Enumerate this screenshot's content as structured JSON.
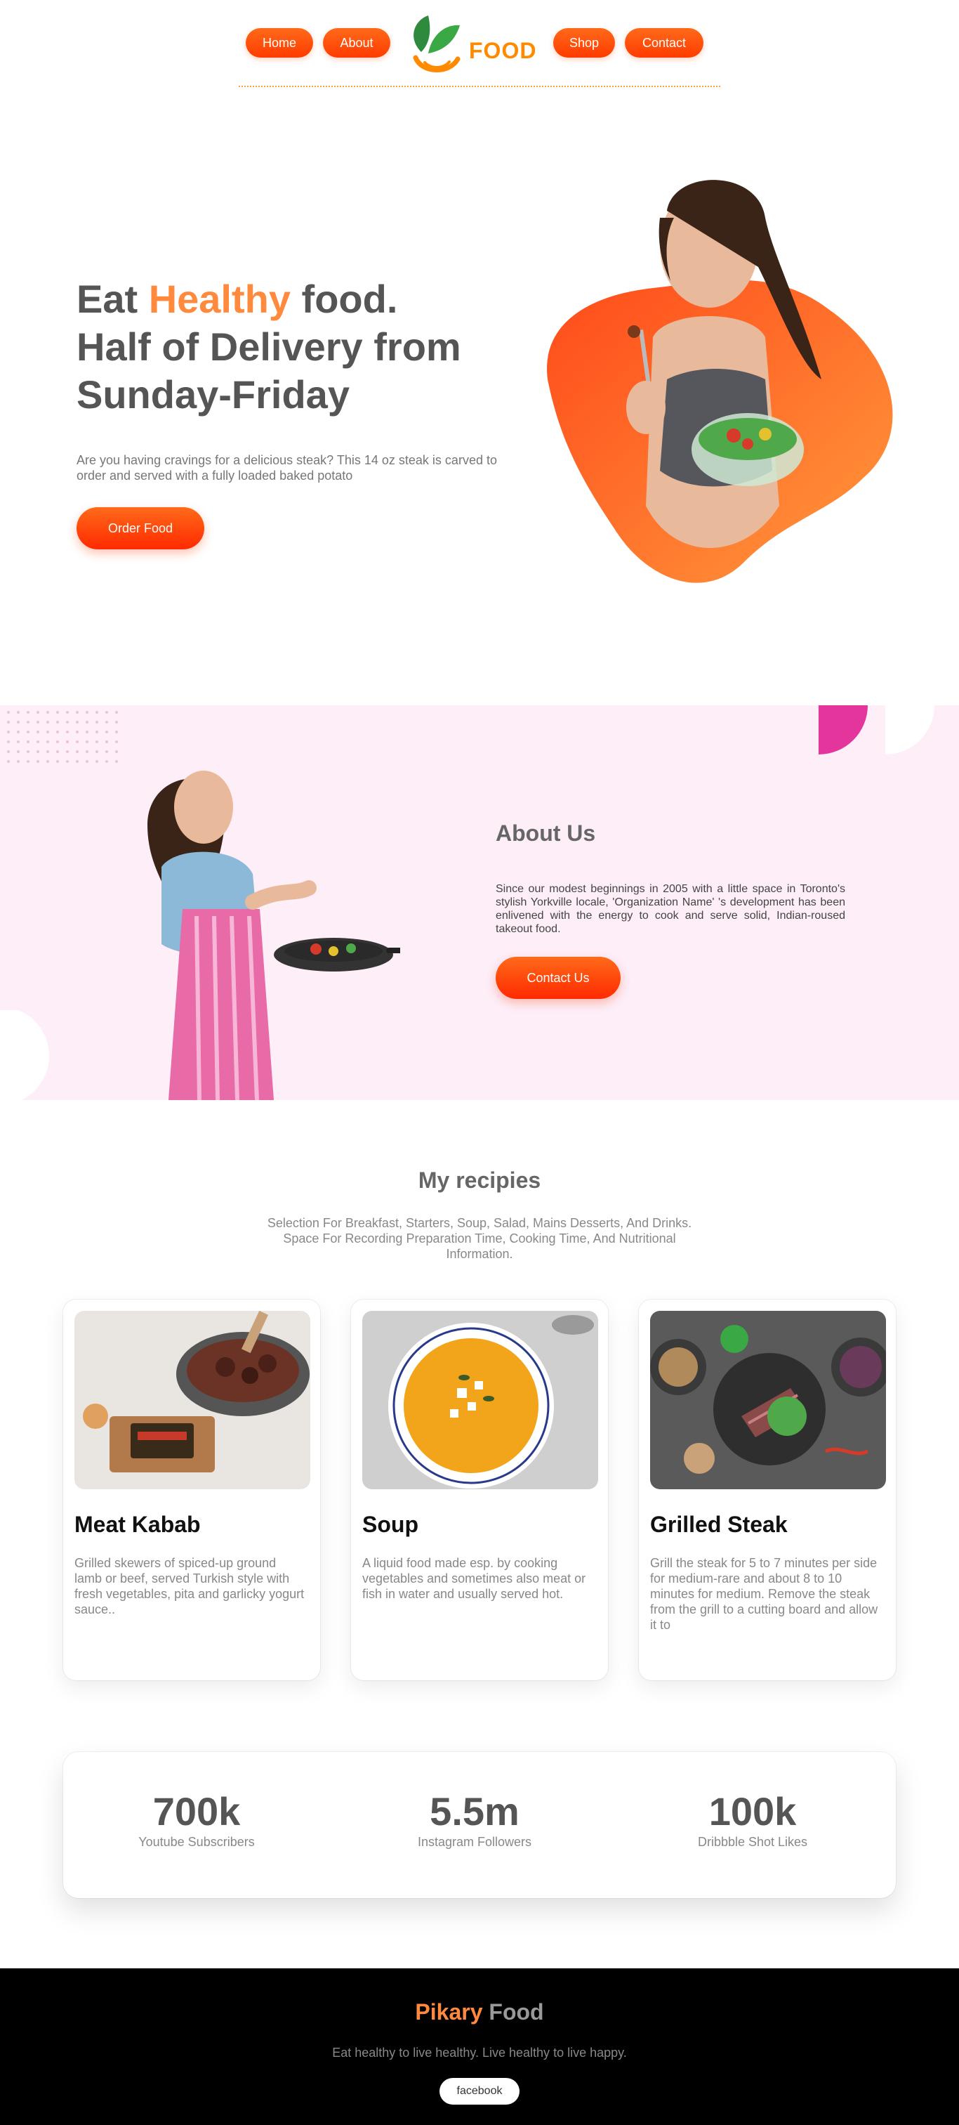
{
  "nav": {
    "items": [
      {
        "label": "Home"
      },
      {
        "label": "About"
      },
      {
        "label": "Shop"
      },
      {
        "label": "Contact"
      }
    ],
    "logo_text": "FOOD"
  },
  "hero": {
    "title_part1": "Eat ",
    "title_accent": "Healthy",
    "title_part2": " food.",
    "title_line2": "Half of Delivery from",
    "title_line3": "Sunday-Friday",
    "description": "Are you having cravings for a delicious steak? This 14 oz steak is carved to order and served with a fully loaded baked potato",
    "cta_label": "Order Food"
  },
  "about": {
    "title": "About Us",
    "text": "Since our modest beginnings in 2005 with a little space in Toronto's stylish Yorkville locale, 'Organization Name' 's development has been enlivened with the energy to cook and serve solid, Indian-roused takeout food.",
    "cta_label": "Contact Us"
  },
  "recipes": {
    "title": "My recipies",
    "subtitle": "Selection For Breakfast, Starters, Soup, Salad, Mains Desserts, And Drinks. Space For Recording Preparation Time, Cooking Time, And Nutritional Information.",
    "cards": [
      {
        "title": "Meat Kabab",
        "text": "Grilled skewers of spiced-up ground lamb or beef, served Turkish style with fresh vegetables, pita and garlicky yogurt sauce.."
      },
      {
        "title": "Soup",
        "text": "A liquid food made esp. by cooking vegetables and sometimes also meat or fish in water and usually served hot."
      },
      {
        "title": "Grilled Steak",
        "text": "Grill the steak for 5 to 7 minutes per side for medium-rare and about 8 to 10 minutes for medium. Remove the steak from the grill to a cutting board and allow it to"
      }
    ]
  },
  "stats": [
    {
      "value": "700k",
      "label": "Youtube Subscribers"
    },
    {
      "value": "5.5m",
      "label": "Instagram Followers"
    },
    {
      "value": "100k",
      "label": "Dribbble Shot Likes"
    }
  ],
  "footer": {
    "brand_accent": "Pikary",
    "brand_rest": " Food",
    "tagline": "Eat healthy to live healthy. Live healthy to live happy.",
    "social_label": "facebook"
  },
  "colors": {
    "accent": "#ff8a3d",
    "button": "#ff4a0a",
    "about_bg": "#fdeef8",
    "footer_bg": "#000000"
  }
}
